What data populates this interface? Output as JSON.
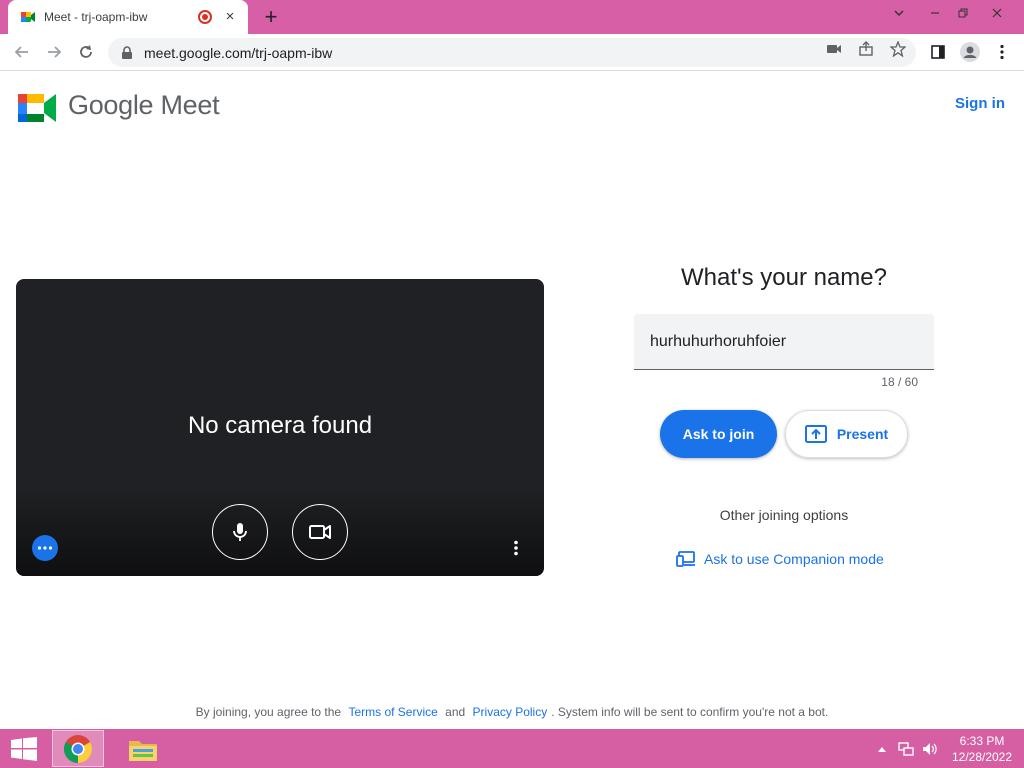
{
  "browser": {
    "tab_title": "Meet - trj-oapm-ibw",
    "tab_close": "×",
    "new_tab": "+",
    "url": "meet.google.com/trj-oapm-ibw"
  },
  "header": {
    "brand_google": "Google",
    "brand_meet": "Meet",
    "sign_in": "Sign in"
  },
  "preview": {
    "message": "No camera found"
  },
  "join": {
    "heading": "What's your name?",
    "name_value": "hurhuhurhoruhfoier",
    "counter": "18 / 60",
    "ask_to_join": "Ask to join",
    "present": "Present",
    "other_options": "Other joining options",
    "companion_mode": "Ask to use Companion mode"
  },
  "footer": {
    "prefix": "By joining, you agree to the",
    "terms": "Terms of Service",
    "and": "and",
    "privacy": "Privacy Policy",
    "suffix": ". System info will be sent to confirm you're not a bot."
  },
  "taskbar": {
    "time": "6:33 PM",
    "date": "12/28/2022"
  },
  "colors": {
    "accent": "#1a73e8",
    "tab_strip": "#d75fa6",
    "taskbar": "#d65fa3",
    "preview_bg": "#202124"
  }
}
